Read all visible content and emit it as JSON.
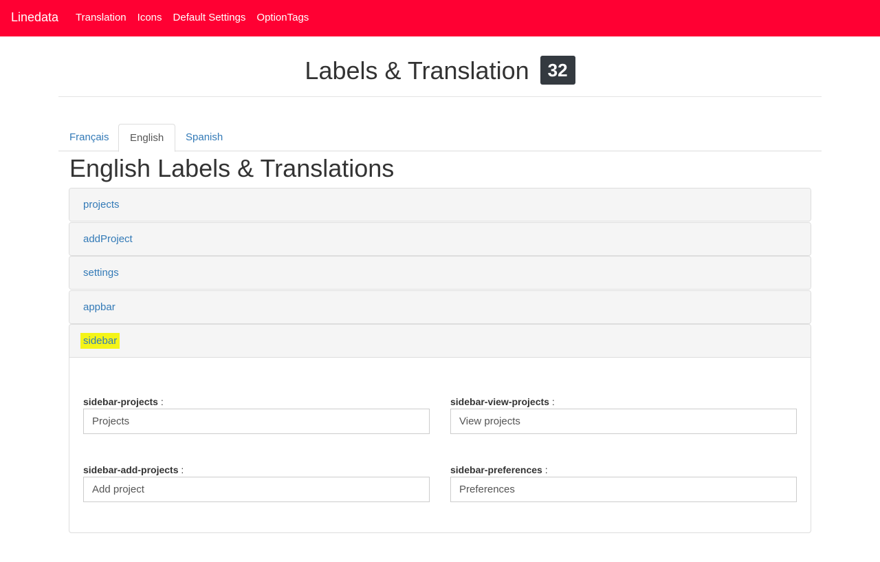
{
  "navbar": {
    "brand": "Linedata",
    "links": [
      "Translation",
      "Icons",
      "Default Settings",
      "OptionTags"
    ]
  },
  "header": {
    "title": "Labels & Translation",
    "badge": "32"
  },
  "tabs": [
    "Français",
    "English",
    "Spanish"
  ],
  "active_tab": "English",
  "section_title": "English Labels & Translations",
  "panels": [
    "projects",
    "addProject",
    "settings",
    "appbar",
    "sidebar"
  ],
  "open_panel": "sidebar",
  "fields": [
    {
      "label": "sidebar-projects",
      "value": "Projects"
    },
    {
      "label": "sidebar-view-projects",
      "value": "View projects"
    },
    {
      "label": "sidebar-add-projects",
      "value": "Add project"
    },
    {
      "label": "sidebar-preferences",
      "value": "Preferences"
    }
  ],
  "colon": ":",
  "colors": {
    "navbar": "#ff0033",
    "badge": "#343a40",
    "link": "#337ab7",
    "highlight": "#f4f418"
  }
}
